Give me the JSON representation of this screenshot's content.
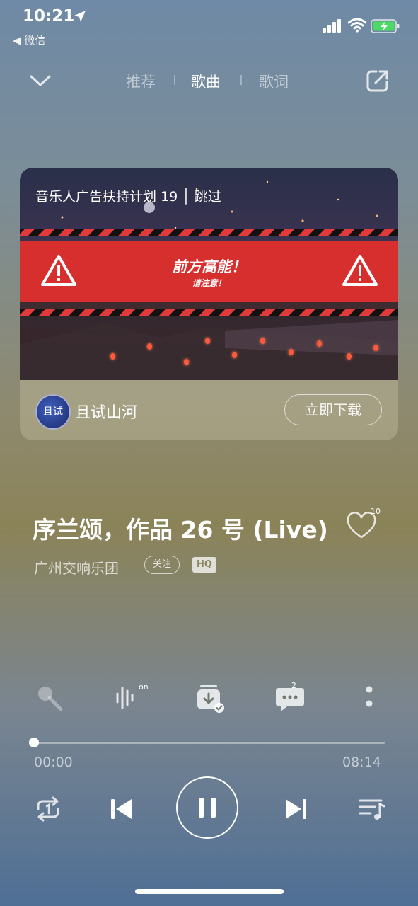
{
  "status_bar": {
    "time": "10:21",
    "back_app": "◀ 微信"
  },
  "nav": {
    "tabs": [
      {
        "label": "推荐",
        "active": false
      },
      {
        "label": "歌曲",
        "active": true
      },
      {
        "label": "歌词",
        "active": false
      }
    ]
  },
  "ad": {
    "title": "音乐人广告扶持计划 19 │ 跳过",
    "banner_title": "前方高能！",
    "banner_subtitle": "请注意！",
    "avatar_text": "且试",
    "name": "且试山河",
    "download_label": "立即下载"
  },
  "song": {
    "title": "序兰颂，作品 26 号 (Live)",
    "like_count": "10",
    "artist": "广州交响乐团",
    "follow_label": "关注",
    "quality_badge": "HQ"
  },
  "functions": {
    "sound_effect_badge": "on",
    "comment_count": "2"
  },
  "progress": {
    "current": "00:00",
    "duration": "08:14",
    "fraction": 0.0
  },
  "colors": {
    "warning_red": "#d72e2e",
    "hazard_black": "#111111"
  }
}
